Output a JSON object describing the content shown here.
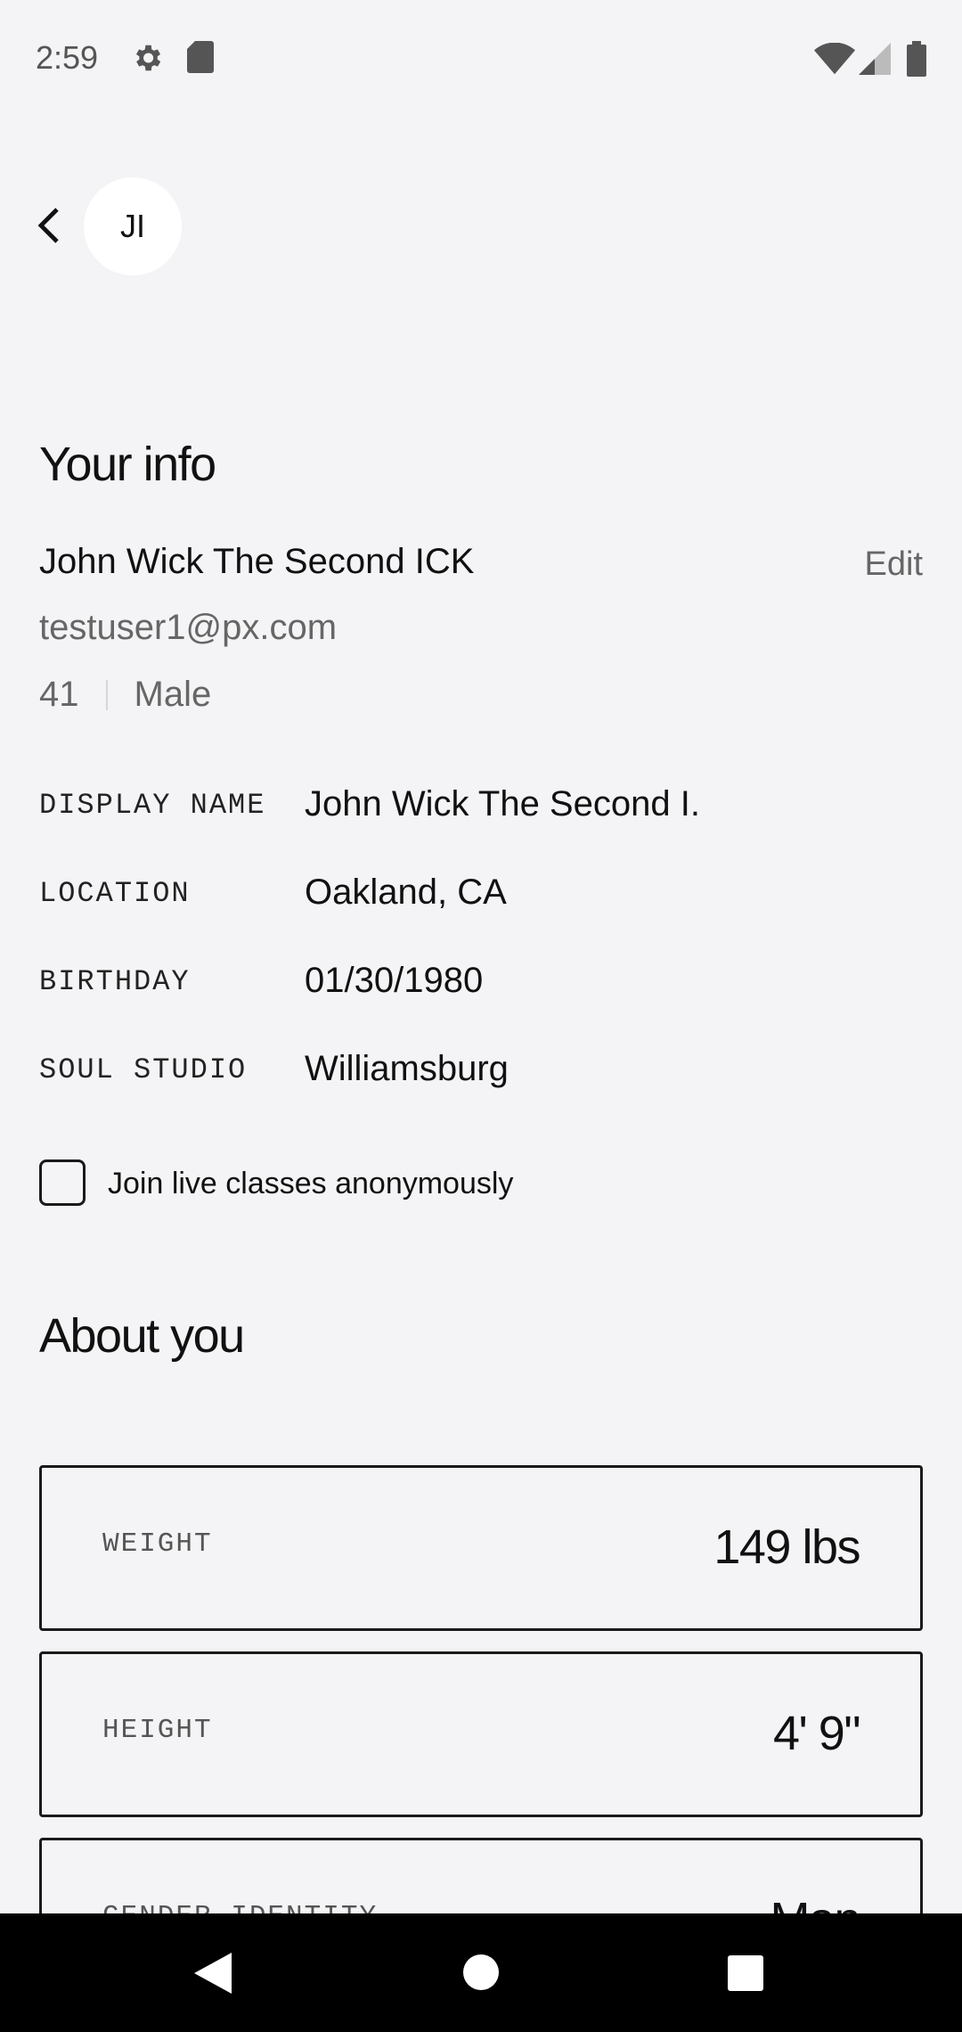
{
  "status_bar": {
    "time": "2:59",
    "icons_left": [
      "gear-icon",
      "sd-card-icon"
    ],
    "icons_right": [
      "wifi-icon",
      "cellular-signal-icon",
      "battery-icon"
    ]
  },
  "header": {
    "back_icon": "chevron-left-icon",
    "avatar_initials": "JI"
  },
  "your_info": {
    "title": "Your info",
    "full_name": "John Wick The Second ICK",
    "edit_label": "Edit",
    "email": "testuser1@px.com",
    "age": "41",
    "gender": "Male",
    "fields": [
      {
        "label": "DISPLAY NAME",
        "value": "John Wick The Second I."
      },
      {
        "label": "LOCATION",
        "value": "Oakland, CA"
      },
      {
        "label": "BIRTHDAY",
        "value": "01/30/1980"
      },
      {
        "label": "SOUL STUDIO",
        "value": "Williamsburg"
      }
    ],
    "anonymous_checkbox": {
      "label": "Join live classes anonymously",
      "checked": false
    }
  },
  "about_you": {
    "title": "About you",
    "cards": [
      {
        "label": "WEIGHT",
        "value": "149 lbs"
      },
      {
        "label": "HEIGHT",
        "value": "4' 9\""
      },
      {
        "label": "GENDER IDENTITY",
        "value": "Man"
      }
    ]
  },
  "nav_bar": {
    "icons": [
      "nav-back-icon",
      "nav-home-icon",
      "nav-recents-icon"
    ]
  }
}
